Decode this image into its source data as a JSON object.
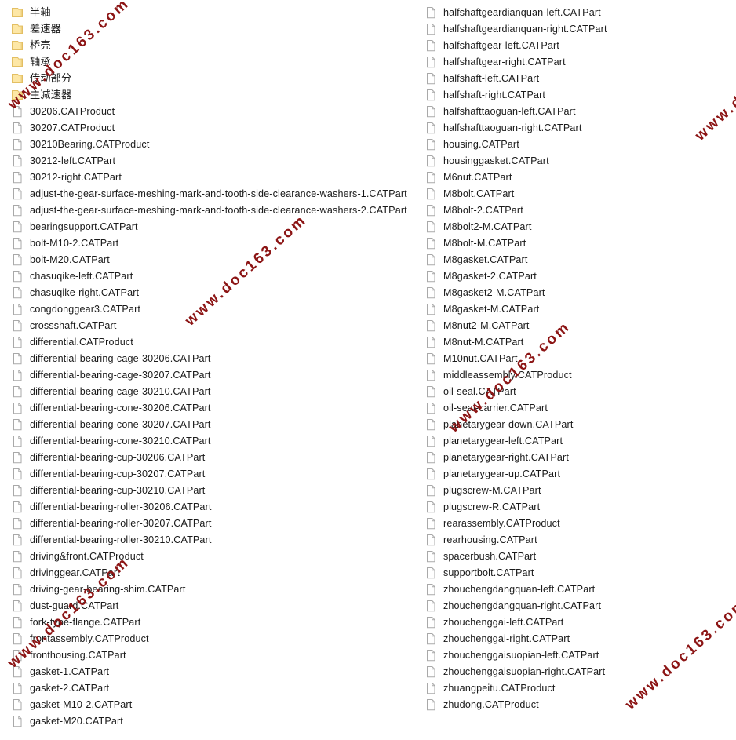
{
  "watermark": {
    "text": "www.doc163.com",
    "color": "#8c1515",
    "instances": 6
  },
  "listing": {
    "view": "list",
    "columns": [
      {
        "name": "left-column",
        "items": [
          {
            "type": "folder",
            "icon": "folder-icon",
            "name": "半轴"
          },
          {
            "type": "folder",
            "icon": "folder-icon",
            "name": "差速器"
          },
          {
            "type": "folder",
            "icon": "folder-icon",
            "name": "桥壳"
          },
          {
            "type": "folder",
            "icon": "folder-icon",
            "name": "轴承"
          },
          {
            "type": "folder",
            "icon": "folder-icon",
            "name": "传动部分"
          },
          {
            "type": "folder",
            "icon": "folder-icon",
            "name": "主减速器"
          },
          {
            "type": "file",
            "icon": "file-icon",
            "name": "30206.CATProduct"
          },
          {
            "type": "file",
            "icon": "file-icon",
            "name": "30207.CATProduct"
          },
          {
            "type": "file",
            "icon": "file-icon",
            "name": "30210Bearing.CATProduct"
          },
          {
            "type": "file",
            "icon": "file-icon",
            "name": "30212-left.CATPart"
          },
          {
            "type": "file",
            "icon": "file-icon",
            "name": "30212-right.CATPart"
          },
          {
            "type": "file",
            "icon": "file-icon",
            "name": "adjust-the-gear-surface-meshing-mark-and-tooth-side-clearance-washers-1.CATPart"
          },
          {
            "type": "file",
            "icon": "file-icon",
            "name": "adjust-the-gear-surface-meshing-mark-and-tooth-side-clearance-washers-2.CATPart"
          },
          {
            "type": "file",
            "icon": "file-icon",
            "name": "bearingsupport.CATPart"
          },
          {
            "type": "file",
            "icon": "file-icon",
            "name": "bolt-M10-2.CATPart"
          },
          {
            "type": "file",
            "icon": "file-icon",
            "name": "bolt-M20.CATPart"
          },
          {
            "type": "file",
            "icon": "file-icon",
            "name": "chasuqike-left.CATPart"
          },
          {
            "type": "file",
            "icon": "file-icon",
            "name": "chasuqike-right.CATPart"
          },
          {
            "type": "file",
            "icon": "file-icon",
            "name": "congdonggear3.CATPart"
          },
          {
            "type": "file",
            "icon": "file-icon",
            "name": "crossshaft.CATPart"
          },
          {
            "type": "file",
            "icon": "file-icon",
            "name": "differential.CATProduct"
          },
          {
            "type": "file",
            "icon": "file-icon",
            "name": "differential-bearing-cage-30206.CATPart"
          },
          {
            "type": "file",
            "icon": "file-icon",
            "name": "differential-bearing-cage-30207.CATPart"
          },
          {
            "type": "file",
            "icon": "file-icon",
            "name": "differential-bearing-cage-30210.CATPart"
          },
          {
            "type": "file",
            "icon": "file-icon",
            "name": "differential-bearing-cone-30206.CATPart"
          },
          {
            "type": "file",
            "icon": "file-icon",
            "name": "differential-bearing-cone-30207.CATPart"
          },
          {
            "type": "file",
            "icon": "file-icon",
            "name": "differential-bearing-cone-30210.CATPart"
          },
          {
            "type": "file",
            "icon": "file-icon",
            "name": "differential-bearing-cup-30206.CATPart"
          },
          {
            "type": "file",
            "icon": "file-icon",
            "name": "differential-bearing-cup-30207.CATPart"
          },
          {
            "type": "file",
            "icon": "file-icon",
            "name": "differential-bearing-cup-30210.CATPart"
          },
          {
            "type": "file",
            "icon": "file-icon",
            "name": "differential-bearing-roller-30206.CATPart"
          },
          {
            "type": "file",
            "icon": "file-icon",
            "name": "differential-bearing-roller-30207.CATPart"
          },
          {
            "type": "file",
            "icon": "file-icon",
            "name": "differential-bearing-roller-30210.CATPart"
          },
          {
            "type": "file",
            "icon": "file-icon",
            "name": "driving&front.CATProduct"
          },
          {
            "type": "file",
            "icon": "file-icon",
            "name": "drivinggear.CATPart"
          },
          {
            "type": "file",
            "icon": "file-icon",
            "name": "driving-gear-bearing-shim.CATPart"
          },
          {
            "type": "file",
            "icon": "file-icon",
            "name": "dust-guard.CATPart"
          },
          {
            "type": "file",
            "icon": "file-icon",
            "name": "fork-type-flange.CATPart"
          },
          {
            "type": "file",
            "icon": "file-icon",
            "name": "frontassembly.CATProduct"
          },
          {
            "type": "file",
            "icon": "file-icon",
            "name": "fronthousing.CATPart"
          },
          {
            "type": "file",
            "icon": "file-icon",
            "name": "gasket-1.CATPart"
          },
          {
            "type": "file",
            "icon": "file-icon",
            "name": "gasket-2.CATPart"
          },
          {
            "type": "file",
            "icon": "file-icon",
            "name": "gasket-M10-2.CATPart"
          },
          {
            "type": "file",
            "icon": "file-icon",
            "name": "gasket-M20.CATPart"
          }
        ]
      },
      {
        "name": "right-column",
        "items": [
          {
            "type": "file",
            "icon": "file-icon",
            "name": "halfshaftgeardianquan-left.CATPart"
          },
          {
            "type": "file",
            "icon": "file-icon",
            "name": "halfshaftgeardianquan-right.CATPart"
          },
          {
            "type": "file",
            "icon": "file-icon",
            "name": "halfshaftgear-left.CATPart"
          },
          {
            "type": "file",
            "icon": "file-icon",
            "name": "halfshaftgear-right.CATPart"
          },
          {
            "type": "file",
            "icon": "file-icon",
            "name": "halfshaft-left.CATPart"
          },
          {
            "type": "file",
            "icon": "file-icon",
            "name": "halfshaft-right.CATPart"
          },
          {
            "type": "file",
            "icon": "file-icon",
            "name": "halfshafttaoguan-left.CATPart"
          },
          {
            "type": "file",
            "icon": "file-icon",
            "name": "halfshafttaoguan-right.CATPart"
          },
          {
            "type": "file",
            "icon": "file-icon",
            "name": "housing.CATPart"
          },
          {
            "type": "file",
            "icon": "file-icon",
            "name": "housinggasket.CATPart"
          },
          {
            "type": "file",
            "icon": "file-icon",
            "name": "M6nut.CATPart"
          },
          {
            "type": "file",
            "icon": "file-icon",
            "name": "M8bolt.CATPart"
          },
          {
            "type": "file",
            "icon": "file-icon",
            "name": "M8bolt-2.CATPart"
          },
          {
            "type": "file",
            "icon": "file-icon",
            "name": "M8bolt2-M.CATPart"
          },
          {
            "type": "file",
            "icon": "file-icon",
            "name": "M8bolt-M.CATPart"
          },
          {
            "type": "file",
            "icon": "file-icon",
            "name": "M8gasket.CATPart"
          },
          {
            "type": "file",
            "icon": "file-icon",
            "name": "M8gasket-2.CATPart"
          },
          {
            "type": "file",
            "icon": "file-icon",
            "name": "M8gasket2-M.CATPart"
          },
          {
            "type": "file",
            "icon": "file-icon",
            "name": "M8gasket-M.CATPart"
          },
          {
            "type": "file",
            "icon": "file-icon",
            "name": "M8nut2-M.CATPart"
          },
          {
            "type": "file",
            "icon": "file-icon",
            "name": "M8nut-M.CATPart"
          },
          {
            "type": "file",
            "icon": "file-icon",
            "name": "M10nut.CATPart"
          },
          {
            "type": "file",
            "icon": "file-icon",
            "name": "middleassembly.CATProduct"
          },
          {
            "type": "file",
            "icon": "file-icon",
            "name": "oil-seal.CATPart"
          },
          {
            "type": "file",
            "icon": "file-icon",
            "name": "oil-seal-carrier.CATPart"
          },
          {
            "type": "file",
            "icon": "file-icon",
            "name": "planetarygear-down.CATPart"
          },
          {
            "type": "file",
            "icon": "file-icon",
            "name": "planetarygear-left.CATPart"
          },
          {
            "type": "file",
            "icon": "file-icon",
            "name": "planetarygear-right.CATPart"
          },
          {
            "type": "file",
            "icon": "file-icon",
            "name": "planetarygear-up.CATPart"
          },
          {
            "type": "file",
            "icon": "file-icon",
            "name": "plugscrew-M.CATPart"
          },
          {
            "type": "file",
            "icon": "file-icon",
            "name": "plugscrew-R.CATPart"
          },
          {
            "type": "file",
            "icon": "file-icon",
            "name": "rearassembly.CATProduct"
          },
          {
            "type": "file",
            "icon": "file-icon",
            "name": "rearhousing.CATPart"
          },
          {
            "type": "file",
            "icon": "file-icon",
            "name": "spacerbush.CATPart"
          },
          {
            "type": "file",
            "icon": "file-icon",
            "name": "supportbolt.CATPart"
          },
          {
            "type": "file",
            "icon": "file-icon",
            "name": "zhouchengdangquan-left.CATPart"
          },
          {
            "type": "file",
            "icon": "file-icon",
            "name": "zhouchengdangquan-right.CATPart"
          },
          {
            "type": "file",
            "icon": "file-icon",
            "name": "zhouchenggai-left.CATPart"
          },
          {
            "type": "file",
            "icon": "file-icon",
            "name": "zhouchenggai-right.CATPart"
          },
          {
            "type": "file",
            "icon": "file-icon",
            "name": "zhouchenggaisuopian-left.CATPart"
          },
          {
            "type": "file",
            "icon": "file-icon",
            "name": "zhouchenggaisuopian-right.CATPart"
          },
          {
            "type": "file",
            "icon": "file-icon",
            "name": "zhuangpeitu.CATProduct"
          },
          {
            "type": "file",
            "icon": "file-icon",
            "name": "zhudong.CATProduct"
          }
        ]
      }
    ]
  }
}
